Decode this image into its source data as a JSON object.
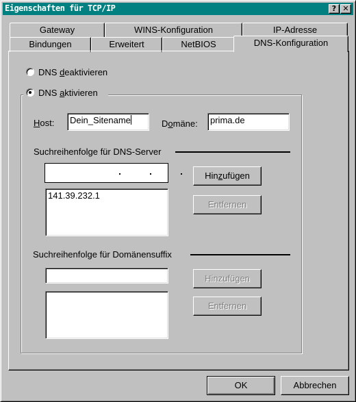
{
  "window": {
    "title": "Eigenschaften für TCP/IP",
    "help_button": "?",
    "close_button": "✕"
  },
  "tabs": {
    "back_row": [
      {
        "label": "Gateway"
      },
      {
        "label": "WINS-Konfiguration"
      },
      {
        "label": "IP-Adresse"
      }
    ],
    "front_row": [
      {
        "label": "Bindungen"
      },
      {
        "label": "Erweitert"
      },
      {
        "label": "NetBIOS"
      },
      {
        "label": "DNS-Konfiguration",
        "active": true
      }
    ]
  },
  "dns": {
    "radio_disable": {
      "pre": "DNS ",
      "accel": "d",
      "post": "eaktivieren",
      "selected": false
    },
    "radio_enable": {
      "pre": "DNS ",
      "accel": "a",
      "post": "ktivieren",
      "selected": true
    },
    "host": {
      "label_accel": "H",
      "label_rest": "ost:",
      "value": "Dein_Sitename"
    },
    "domain": {
      "label_pre": "D",
      "label_accel": "o",
      "label_rest": "mäne:",
      "value": "prima.de"
    },
    "server_section": {
      "title": "Suchreihenfolge für DNS-Server",
      "ip_input": [
        "",
        "",
        "",
        ""
      ],
      "ip_separator": ".",
      "list": [
        "141.39.232.1"
      ],
      "add_button": {
        "pre": "Hin",
        "accel": "z",
        "post": "ufügen",
        "enabled": true
      },
      "remove_button": {
        "label": "Entfernen",
        "enabled": false
      }
    },
    "suffix_section": {
      "title": "Suchreihenfolge für Domänensuffix",
      "input_value": "",
      "list": [],
      "add_button": {
        "label": "Hinzufügen",
        "enabled": false
      },
      "remove_button": {
        "label": "Entfernen",
        "enabled": false
      }
    }
  },
  "footer": {
    "ok_label": "OK",
    "cancel_label": "Abbrechen"
  }
}
